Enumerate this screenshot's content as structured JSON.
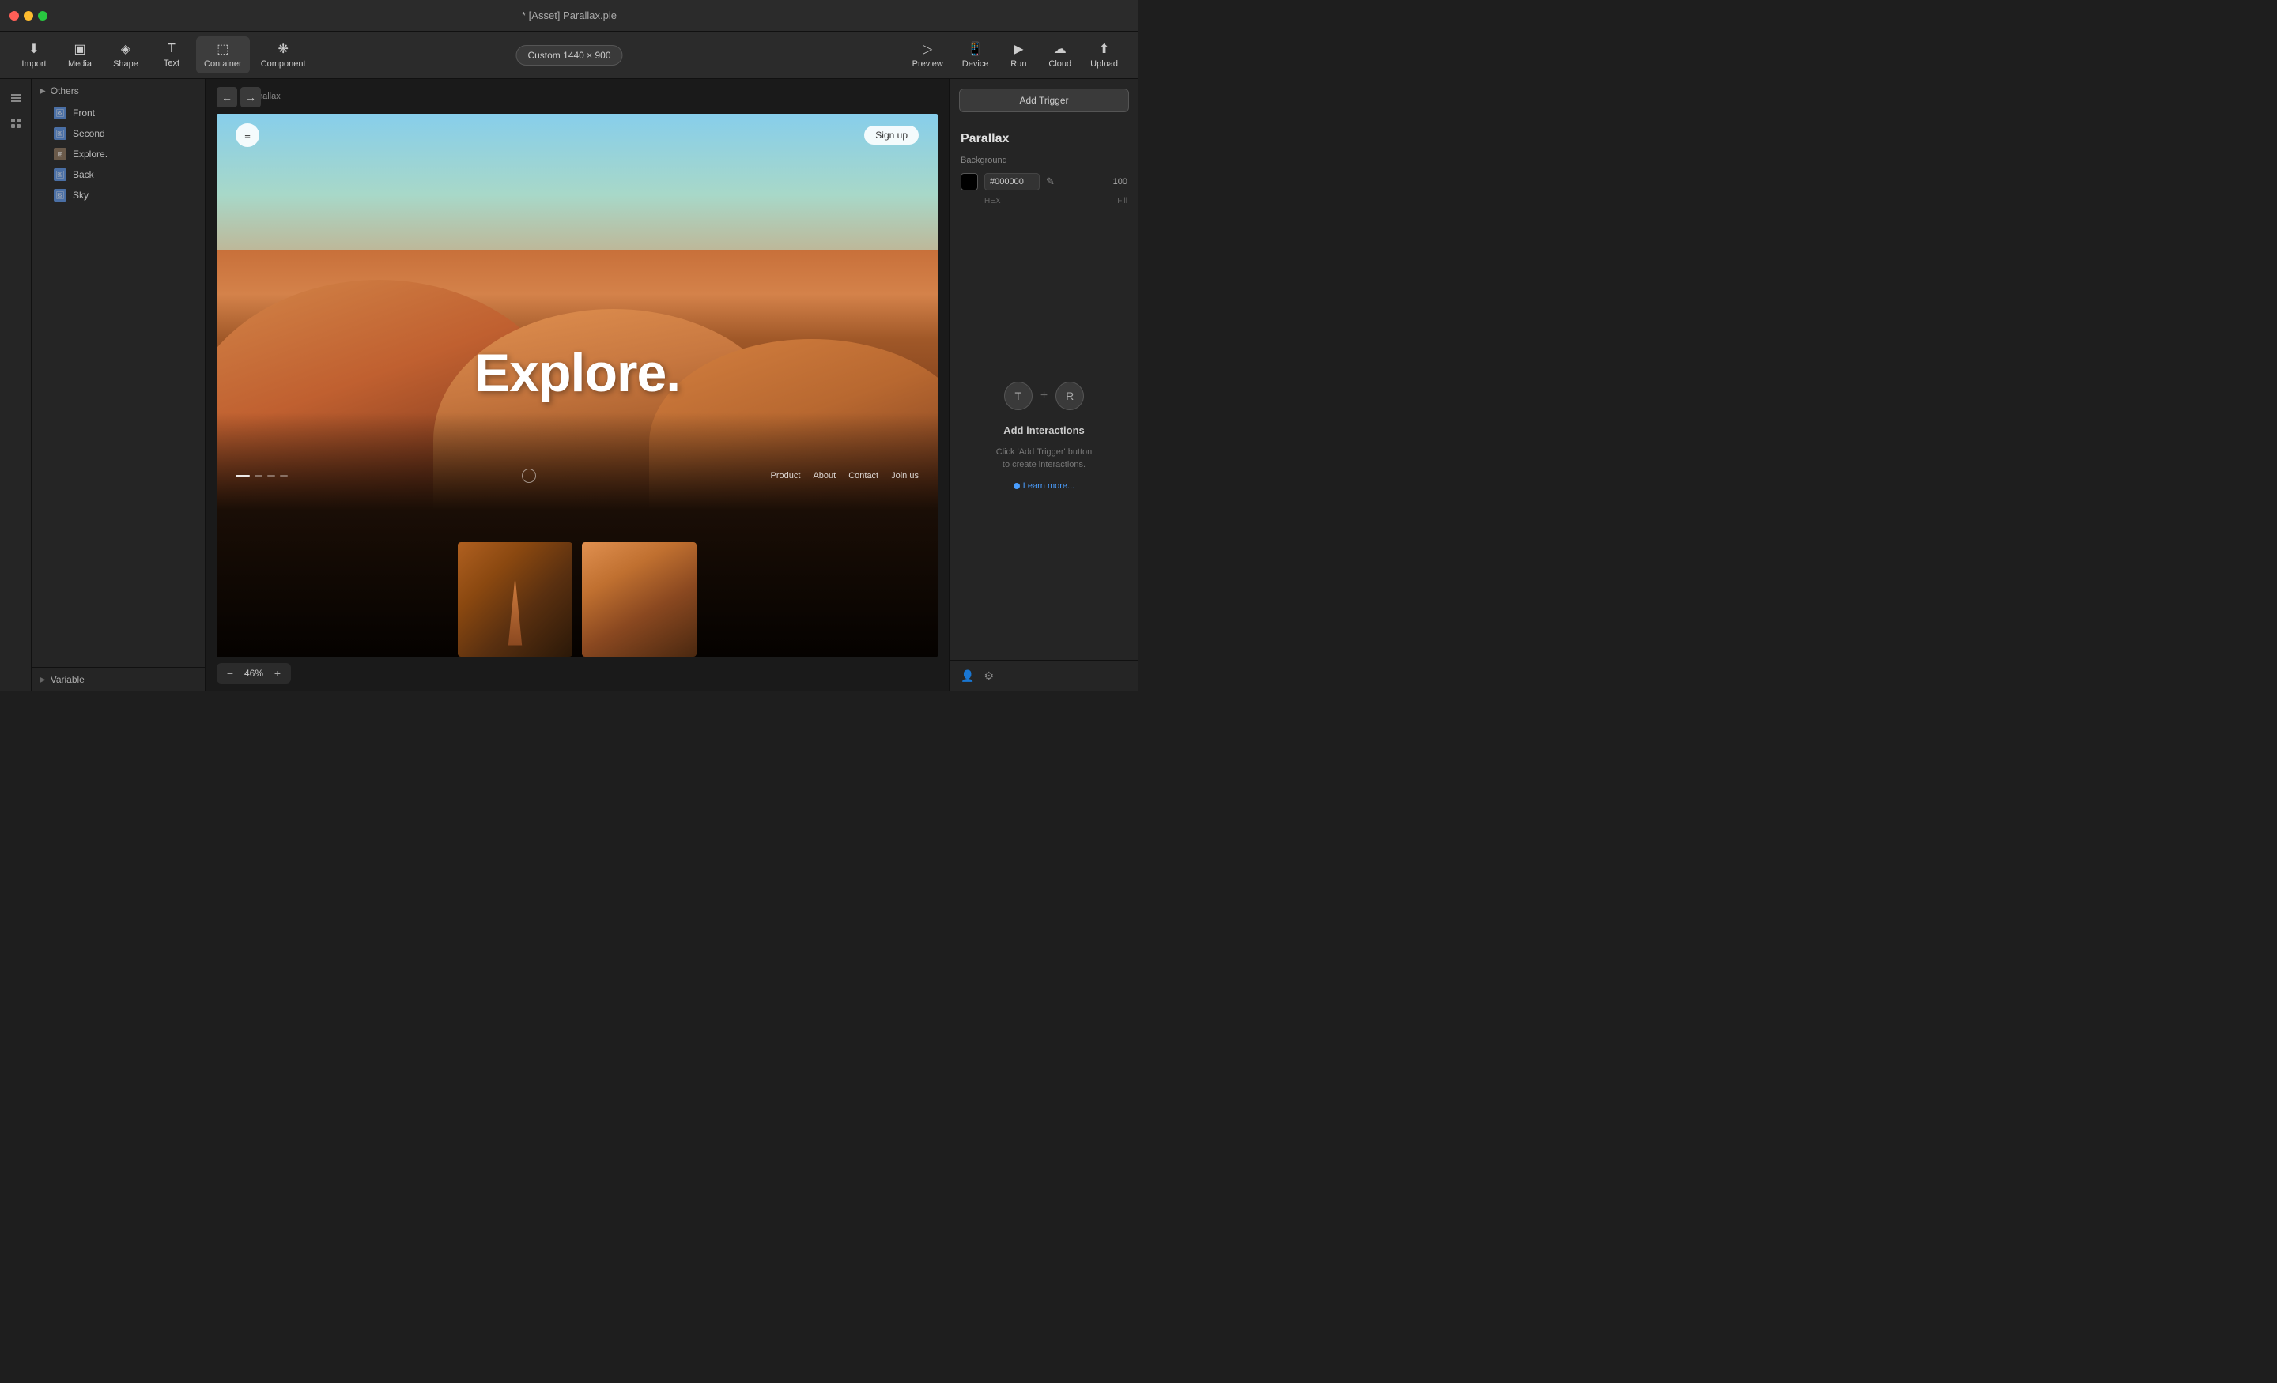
{
  "titlebar": {
    "title": "* [Asset] Parallax.pie"
  },
  "toolbar": {
    "import_label": "Import",
    "media_label": "Media",
    "shape_label": "Shape",
    "text_label": "Text",
    "container_label": "Container",
    "component_label": "Component",
    "canvas_size": "Custom  1440 × 900",
    "preview_label": "Preview",
    "device_label": "Device",
    "run_label": "Run",
    "cloud_label": "Cloud",
    "upload_label": "Upload"
  },
  "layers": {
    "group_label": "Others",
    "items": [
      {
        "name": "Front",
        "type": "img"
      },
      {
        "name": "Second",
        "type": "img"
      },
      {
        "name": "Explore.",
        "type": "group"
      },
      {
        "name": "Back",
        "type": "img"
      },
      {
        "name": "Sky",
        "type": "img"
      }
    ]
  },
  "canvas": {
    "label": "Parallax",
    "zoom_value": "46%"
  },
  "scene": {
    "menu_icon": "≡",
    "signup_label": "Sign up",
    "explore_title": "Explore.",
    "nav_links": [
      "Product",
      "About",
      "Contact",
      "Join us"
    ],
    "image1_alt": "Desert person",
    "image2_alt": "Desert dunes"
  },
  "right_panel": {
    "add_trigger_label": "Add Trigger",
    "component_name": "Parallax",
    "background_label": "Background",
    "hex_value": "#000000",
    "fill_value": "100",
    "hex_label": "HEX",
    "fill_label": "Fill",
    "eyedropper_icon": "✎",
    "interaction_t_icon": "T",
    "interaction_plus": "+",
    "interaction_r_icon": "R",
    "interactions_title": "Add interactions",
    "interactions_desc": "Click 'Add Trigger' button\nto create interactions.",
    "learn_more_label": "Learn more...",
    "user_icon": "👤",
    "settings_icon": "⚙"
  },
  "variable": {
    "label": "Variable"
  }
}
